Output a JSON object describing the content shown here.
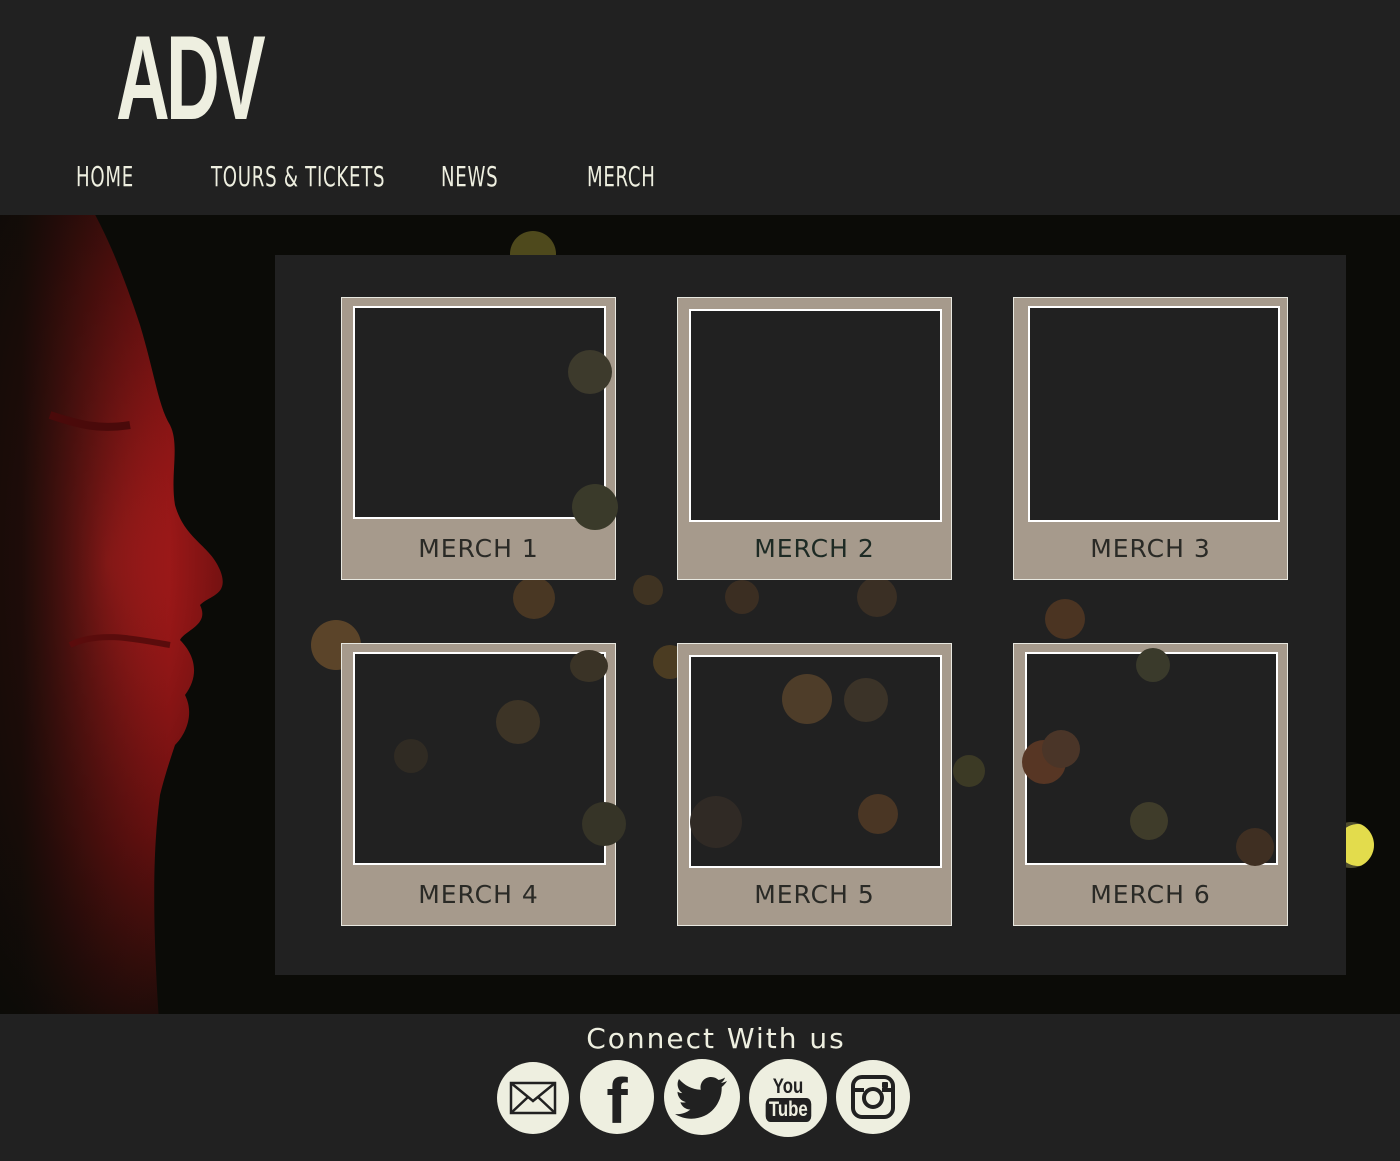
{
  "header": {
    "logo": "ADV",
    "nav": [
      {
        "label": "HOME"
      },
      {
        "label": "TOURS & TICKETS"
      },
      {
        "label": "NEWS"
      },
      {
        "label": "MERCH"
      }
    ]
  },
  "merch": {
    "items": [
      {
        "label": "MERCH 1"
      },
      {
        "label": "MERCH 2"
      },
      {
        "label": "MERCH 3"
      },
      {
        "label": "MERCH 4"
      },
      {
        "label": "MERCH 5"
      },
      {
        "label": "MERCH 6"
      }
    ]
  },
  "footer": {
    "heading": "Connect With us",
    "social": [
      {
        "icon": "email-icon"
      },
      {
        "icon": "facebook-icon",
        "glyph": "f"
      },
      {
        "icon": "twitter-icon"
      },
      {
        "icon": "youtube-icon",
        "text_top": "You",
        "text_bottom": "Tube"
      },
      {
        "icon": "instagram-icon"
      }
    ]
  },
  "colors": {
    "page_bg": "#212121",
    "hero_bg": "#0b0b07",
    "card_bg": "#a69a8c",
    "text_light": "#eeefe0",
    "face_red": "#b01d1d",
    "accent_yellow": "#e3dc4c"
  }
}
